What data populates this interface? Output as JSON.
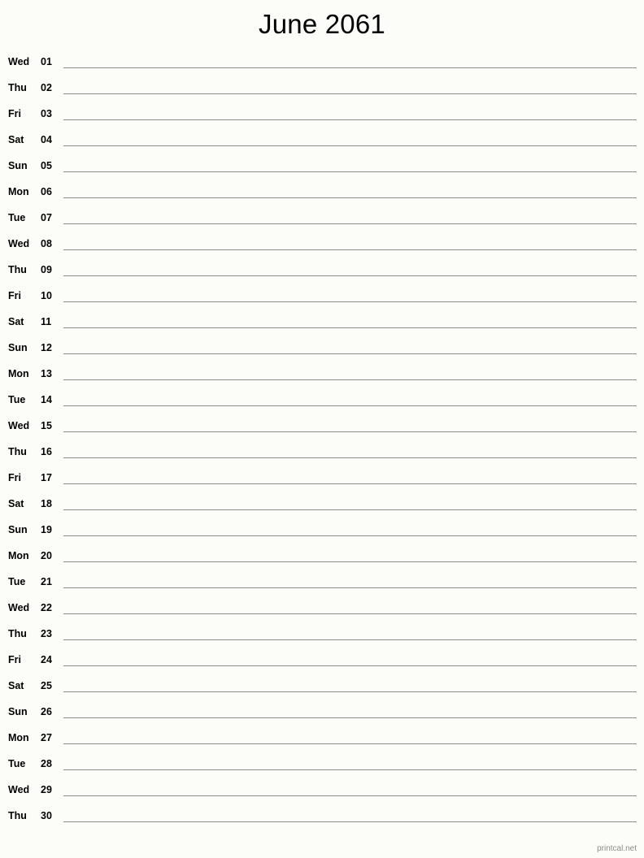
{
  "document": {
    "title": "June 2061",
    "month": "June",
    "year": "2061",
    "type": "printable-notes-calendar",
    "background_color": "#fcfdf8",
    "rule_line_color": "#8a8d88",
    "text_color": "#000000",
    "footer_color": "#8d8d8d"
  },
  "footer": {
    "credit": "printcal.net"
  },
  "calendar": {
    "days": [
      {
        "weekday": "Wed",
        "date": "01"
      },
      {
        "weekday": "Thu",
        "date": "02"
      },
      {
        "weekday": "Fri",
        "date": "03"
      },
      {
        "weekday": "Sat",
        "date": "04"
      },
      {
        "weekday": "Sun",
        "date": "05"
      },
      {
        "weekday": "Mon",
        "date": "06"
      },
      {
        "weekday": "Tue",
        "date": "07"
      },
      {
        "weekday": "Wed",
        "date": "08"
      },
      {
        "weekday": "Thu",
        "date": "09"
      },
      {
        "weekday": "Fri",
        "date": "10"
      },
      {
        "weekday": "Sat",
        "date": "11"
      },
      {
        "weekday": "Sun",
        "date": "12"
      },
      {
        "weekday": "Mon",
        "date": "13"
      },
      {
        "weekday": "Tue",
        "date": "14"
      },
      {
        "weekday": "Wed",
        "date": "15"
      },
      {
        "weekday": "Thu",
        "date": "16"
      },
      {
        "weekday": "Fri",
        "date": "17"
      },
      {
        "weekday": "Sat",
        "date": "18"
      },
      {
        "weekday": "Sun",
        "date": "19"
      },
      {
        "weekday": "Mon",
        "date": "20"
      },
      {
        "weekday": "Tue",
        "date": "21"
      },
      {
        "weekday": "Wed",
        "date": "22"
      },
      {
        "weekday": "Thu",
        "date": "23"
      },
      {
        "weekday": "Fri",
        "date": "24"
      },
      {
        "weekday": "Sat",
        "date": "25"
      },
      {
        "weekday": "Sun",
        "date": "26"
      },
      {
        "weekday": "Mon",
        "date": "27"
      },
      {
        "weekday": "Tue",
        "date": "28"
      },
      {
        "weekday": "Wed",
        "date": "29"
      },
      {
        "weekday": "Thu",
        "date": "30"
      }
    ]
  }
}
